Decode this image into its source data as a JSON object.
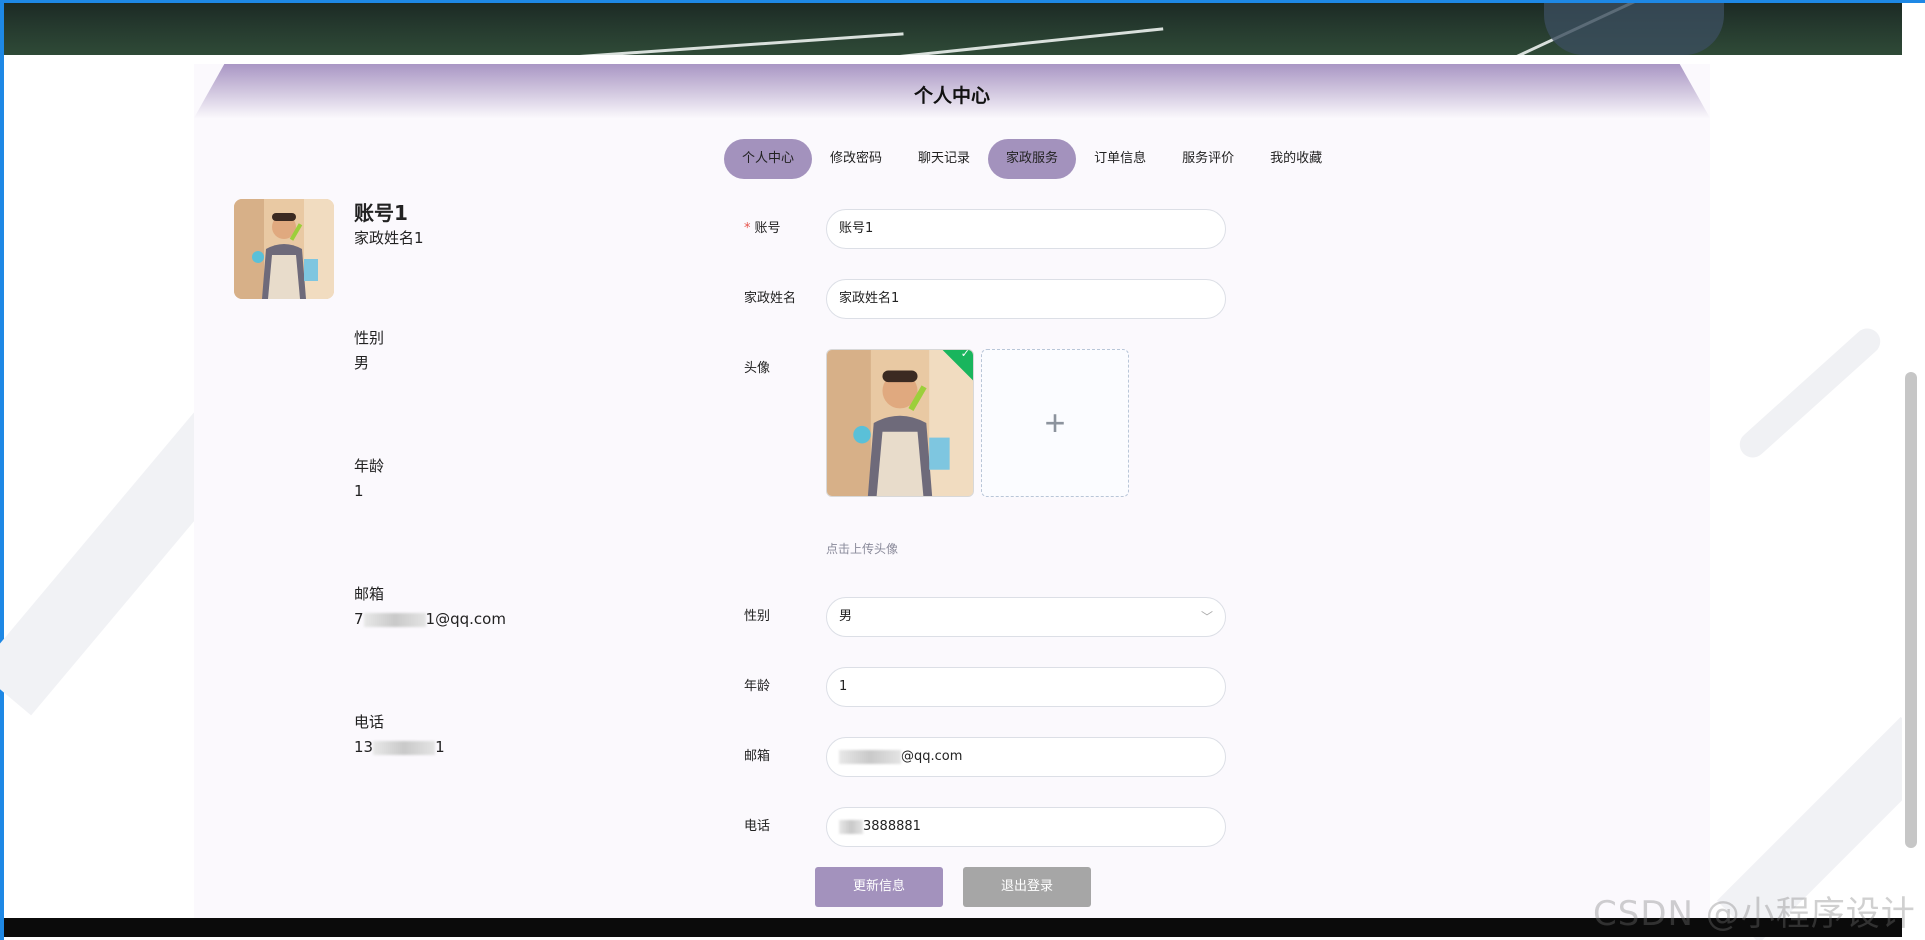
{
  "panel": {
    "title": "个人中心"
  },
  "tabs": [
    {
      "label": "个人中心",
      "active": true
    },
    {
      "label": "修改密码",
      "active": false
    },
    {
      "label": "聊天记录",
      "active": false
    },
    {
      "label": "家政服务",
      "active": true
    },
    {
      "label": "订单信息",
      "active": false
    },
    {
      "label": "服务评价",
      "active": false
    },
    {
      "label": "我的收藏",
      "active": false
    }
  ],
  "profile": {
    "account": "账号1",
    "name": "家政姓名1",
    "gender_label": "性别",
    "gender": "男",
    "age_label": "年龄",
    "age": "1",
    "email_label": "邮箱",
    "email_prefix": "7",
    "email_suffix": "1@qq.com",
    "phone_label": "电话",
    "phone_prefix": "13",
    "phone_suffix": "1"
  },
  "form": {
    "account_label": "账号",
    "account_value": "账号1",
    "name_label": "家政姓名",
    "name_value": "家政姓名1",
    "avatar_label": "头像",
    "upload_hint": "点击上传头像",
    "upload_plus": "+",
    "upload_check": "✓",
    "gender_label": "性别",
    "gender_value": "男",
    "gender_arrow": "﹀",
    "age_label": "年龄",
    "age_value": "1",
    "email_label": "邮箱",
    "email_value": "@qq.com",
    "phone_label": "电话",
    "phone_value": "3888881"
  },
  "buttons": {
    "update": "更新信息",
    "logout": "退出登录"
  },
  "watermark": "CSDN @小程序设计",
  "colors": {
    "accent": "#a392bd",
    "logout": "#a6a6a6",
    "success": "#19b55d",
    "required": "#e5534b"
  }
}
